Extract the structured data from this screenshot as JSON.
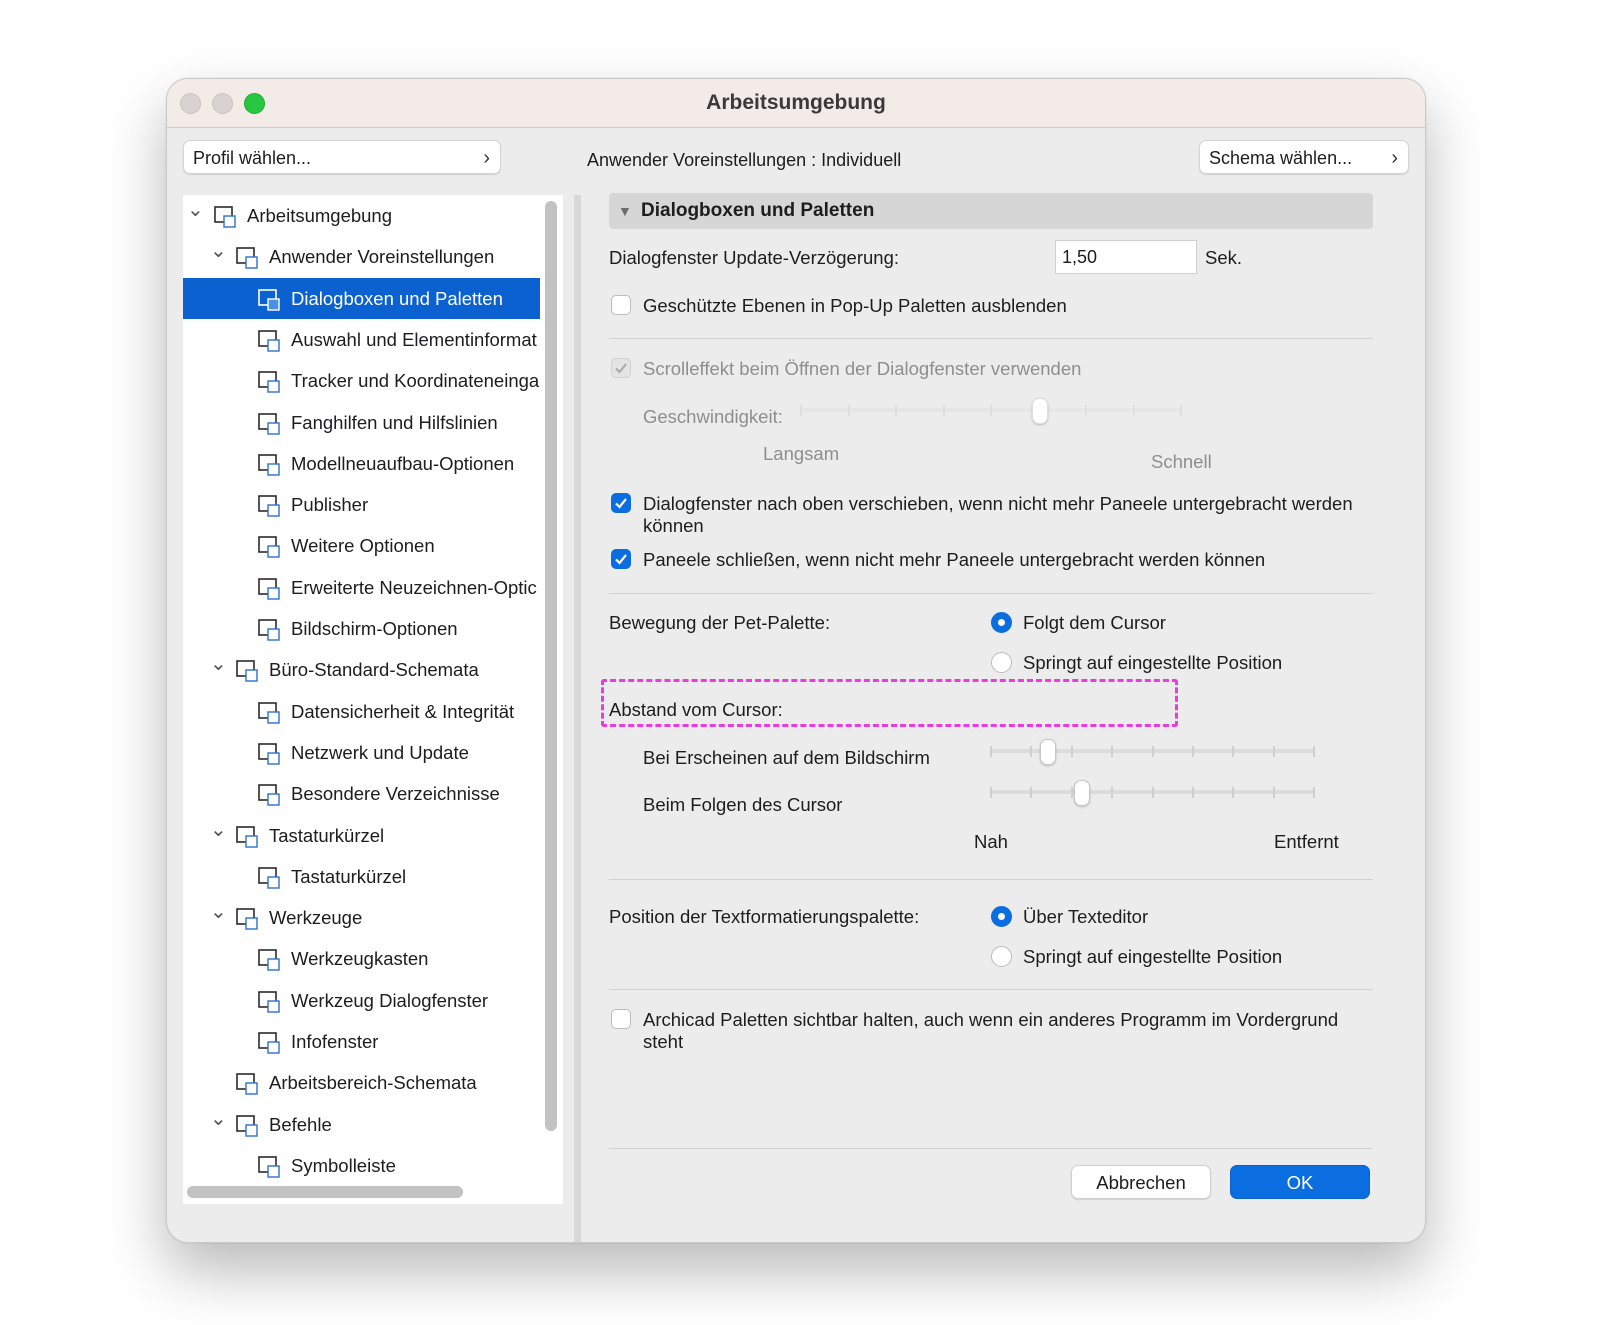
{
  "window": {
    "title": "Arbeitsumgebung"
  },
  "toolbar": {
    "profile_button": "Profil wählen...",
    "preset_label": "Anwender Voreinstellungen : Individuell",
    "schema_button": "Schema wählen..."
  },
  "tree": {
    "items": [
      {
        "label": "Arbeitsumgebung",
        "icon": "workspace-icon"
      },
      {
        "label": "Anwender Voreinstellungen",
        "icon": "user-preferences-icon"
      },
      {
        "label": "Dialogboxen und Paletten",
        "icon": "dialogs-palettes-icon"
      },
      {
        "label": "Auswahl und Elementinformat",
        "icon": "selection-info-icon"
      },
      {
        "label": "Tracker und Koordinateneinga",
        "icon": "xyz-tracker-icon"
      },
      {
        "label": "Fanghilfen und Hilfslinien",
        "icon": "snap-guides-icon"
      },
      {
        "label": "Modellneuaufbau-Optionen",
        "icon": "model-rebuild-icon"
      },
      {
        "label": "Publisher",
        "icon": "publisher-icon"
      },
      {
        "label": "Weitere Optionen",
        "icon": "more-options-icon"
      },
      {
        "label": "Erweiterte Neuzeichnen-Optic",
        "icon": "redraw-options-icon"
      },
      {
        "label": "Bildschirm-Optionen",
        "icon": "screen-options-icon"
      },
      {
        "label": "Büro-Standard-Schemata",
        "icon": "office-standard-icon"
      },
      {
        "label": "Datensicherheit & Integrität",
        "icon": "data-safety-icon"
      },
      {
        "label": "Netzwerk und Update",
        "icon": "globe-icon"
      },
      {
        "label": "Besondere Verzeichnisse",
        "icon": "folder-icon"
      },
      {
        "label": "Tastaturkürzel",
        "icon": "shortcuts-group-icon"
      },
      {
        "label": "Tastaturkürzel",
        "icon": "shortcut-arrow-icon"
      },
      {
        "label": "Werkzeuge",
        "icon": "tools-icon"
      },
      {
        "label": "Werkzeugkasten",
        "icon": "toolbox-icon"
      },
      {
        "label": "Werkzeug Dialogfenster",
        "icon": "tool-dialog-icon"
      },
      {
        "label": "Infofenster",
        "icon": "info-box-icon"
      },
      {
        "label": "Arbeitsbereich-Schemata",
        "icon": "workspace-schemes-icon"
      },
      {
        "label": "Befehle",
        "icon": "commands-icon"
      },
      {
        "label": "Symbolleiste",
        "icon": "toolbar-icon"
      }
    ]
  },
  "panel": {
    "section_title": "Dialogboxen und Paletten",
    "update_delay_label": "Dialogfenster Update-Verzögerung:",
    "update_delay_value": "1,50",
    "update_delay_unit": "Sek.",
    "hide_protected_layers": {
      "label": "Geschützte Ebenen in Pop-Up Paletten ausblenden",
      "checked": false
    },
    "scroll_effect": {
      "label": "Scrolleffekt beim Öffnen der Dialogfenster verwenden",
      "checked": true,
      "enabled": false
    },
    "speed_label": "Geschwindigkeit:",
    "speed_min_label": "Langsam",
    "speed_max_label": "Schnell",
    "speed_level": 0.63,
    "move_dialogs_up": {
      "label_line1": "Dialogfenster nach oben verschieben, wenn nicht mehr Paneele untergebracht werden",
      "label_line2": "können",
      "checked": true
    },
    "close_panels": {
      "label": "Paneele schließen, wenn nicht mehr Paneele untergebracht werden können",
      "checked": true
    },
    "pet_palette_label": "Bewegung der Pet-Palette:",
    "pet_palette_options": [
      {
        "label": "Folgt dem Cursor",
        "selected": true
      },
      {
        "label": "Springt auf eingestellte Position",
        "selected": false
      }
    ],
    "cursor_distance_label": "Abstand vom Cursor:",
    "appear_label": "Bei Erscheinen auf dem Bildschirm",
    "appear_level": 0.16,
    "follow_label": "Beim Folgen des Cursor",
    "follow_level": 0.27,
    "near_label": "Nah",
    "far_label": "Entfernt",
    "text_palette_label": "Position der Textformatierungspalette:",
    "text_palette_options": [
      {
        "label": "Über Texteditor",
        "selected": true
      },
      {
        "label": "Springt auf eingestellte Position",
        "selected": false
      }
    ],
    "keep_visible": {
      "label_line1": "Archicad Paletten sichtbar halten, auch wenn ein anderes Programm im Vordergrund",
      "label_line2": "steht",
      "checked": false
    }
  },
  "buttons": {
    "cancel": "Abbrechen",
    "ok": "OK"
  },
  "colors": {
    "accent": "#0b6ee0",
    "selection": "#0b61d0",
    "highlight": "#ea3ae0"
  }
}
